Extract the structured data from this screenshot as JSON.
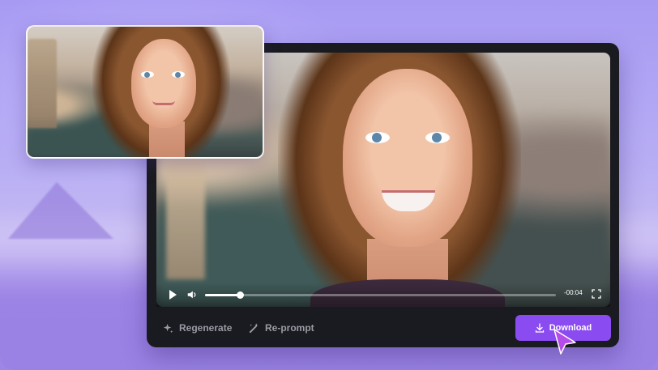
{
  "player": {
    "time_remaining": "-00:04",
    "progress": 0.1
  },
  "actions": {
    "regenerate_label": "Regenerate",
    "reprompt_label": "Re-prompt",
    "download_label": "Download"
  },
  "colors": {
    "accent": "#8a4bf0",
    "card_background": "#1a1b20",
    "action_text": "#9a9ba4"
  },
  "icons": {
    "play": "play-icon",
    "volume": "volume-icon",
    "fullscreen": "fullscreen-icon",
    "regenerate": "sparkle-icon",
    "reprompt": "magic-wand-icon",
    "download": "download-icon",
    "cursor": "cursor-pointer-icon"
  }
}
